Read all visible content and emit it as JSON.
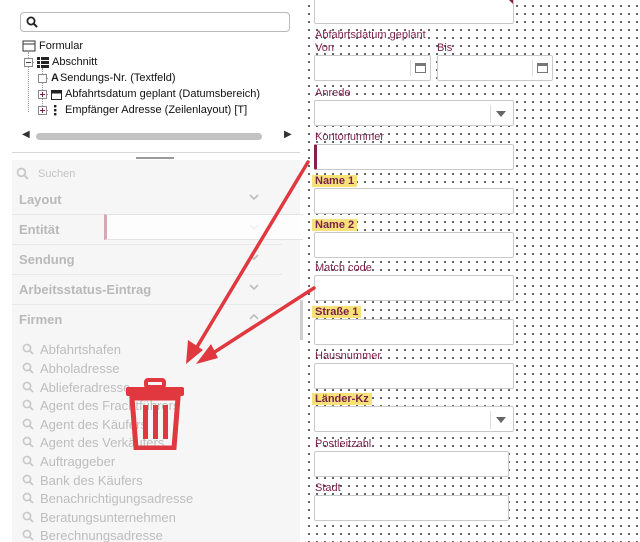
{
  "tree": {
    "search": {
      "placeholder": ""
    },
    "nodes": [
      {
        "label": "Formular",
        "icon": "form-icon"
      },
      {
        "label": "Abschnitt",
        "icon": "section-icon"
      },
      {
        "label": "Sendungs-Nr. (Textfeld)",
        "icon": "textfield-icon"
      },
      {
        "label": "Abfahrtsdatum geplant (Datumsbereich)",
        "icon": "daterange-icon"
      },
      {
        "label": "Empfänger Adresse (Zeilenlayout) [T]",
        "icon": "rowlayout-icon"
      }
    ]
  },
  "toolbox": {
    "search_placeholder": "Suchen",
    "categories": [
      "Layout",
      "Entität",
      "Sendung",
      "Arbeitsstatus-Eintrag",
      "Firmen"
    ],
    "items": [
      "Abfahrtshafen",
      "Abholadresse",
      "Ablieferadresse",
      "Agent des Frachtführers",
      "Agent des Käufers",
      "Agent des Verkäufers",
      "Auftraggeber",
      "Bank des Käufers",
      "Benachrichtigungsadresse",
      "Beratungsunternehmen",
      "Berechnungsadresse"
    ]
  },
  "form": {
    "abfahrtsdatum_label": "Abfahrtsdatum geplant",
    "von_label": "Von",
    "bis_label": "Bis",
    "anrede_label": "Anrede",
    "kontonummer_label": "Kontonummer",
    "name1_label": "Name 1",
    "name2_label": "Name 2",
    "matchcode_label": "Match code",
    "strasse1_label": "Straße 1",
    "hausnummer_label": "Hausnummer",
    "laenderkz_label": "Länder-Kz",
    "postleitzahl_label": "Postleitzahl",
    "stadt_label": "Stadt"
  },
  "colors": {
    "label": "#7a1f4a",
    "highlight": "#f7e27a",
    "annotation_red": "#e0383e",
    "accent": "#8a1e4c"
  }
}
